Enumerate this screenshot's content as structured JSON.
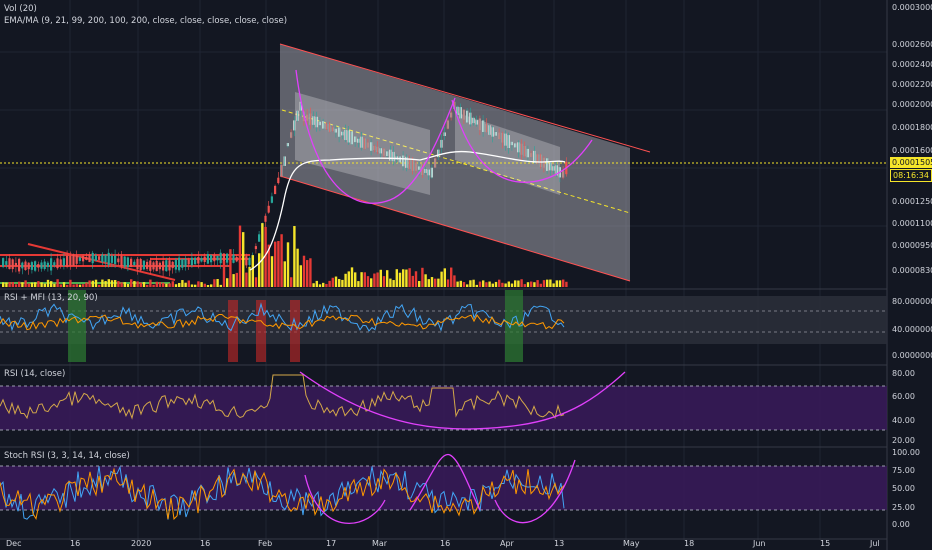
{
  "indicators": {
    "volume": "Vol (20)",
    "ema": "EMA/MA (9, 21, 99, 200, 100, 200, close, close, close, close, close)",
    "rsi_mfi": "RSI + MFI (13, 20, 90)",
    "rsi": "RSI (14, close)",
    "stoch": "Stoch RSI (3, 3, 14, 14, close)"
  },
  "price_badge": {
    "price": "0.0001505",
    "countdown": "08:16:34"
  },
  "price_ticks": [
    "0.0003000",
    "0.0002600",
    "0.0002400",
    "0.0002200",
    "0.0002000",
    "0.0001800",
    "0.0001600",
    "0.0001250",
    "0.0001100",
    "0.0000950",
    "0.0000830"
  ],
  "rsi_mfi_ticks": [
    "80.0000000",
    "40.0000000",
    "0.0000000"
  ],
  "rsi_ticks": [
    "80.00",
    "60.00",
    "40.00",
    "20.00"
  ],
  "stoch_ticks": [
    "100.00",
    "75.00",
    "50.00",
    "25.00",
    "0.00"
  ],
  "x_ticks": [
    "Dec",
    "16",
    "2020",
    "16",
    "Feb",
    "17",
    "Mar",
    "16",
    "Apr",
    "13",
    "May",
    "18",
    "Jun",
    "15",
    "Jul"
  ],
  "colors": {
    "up": "#f5e52a",
    "down": "#ef5350",
    "panel_bg": "#3a1a5a",
    "magenta": "#e040fb",
    "channel": "#ff5252",
    "ema": "#ffffff"
  },
  "chart_data": {
    "type": "line",
    "symbol_scale": "price",
    "channel_top": [
      [
        0.00026,
        "Feb 1"
      ],
      [
        0.000168,
        "May 1"
      ]
    ],
    "current_price": 0.0001505
  }
}
